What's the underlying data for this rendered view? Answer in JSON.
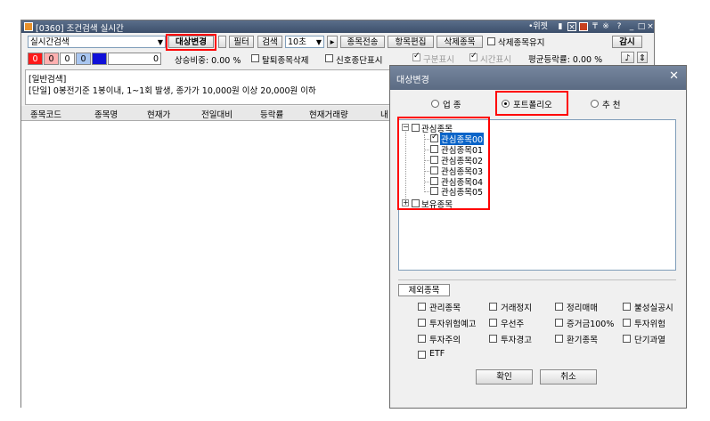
{
  "window": {
    "title": "[0360] 조건검색 실시간",
    "titlebar_icons": [
      "•위젯",
      "lock-icon",
      "x-box-icon",
      "panel-icon",
      "pin-icon",
      "asterisk-icon",
      "?",
      "_",
      "□",
      "×"
    ]
  },
  "toolbar": {
    "search_type": "실시간검색",
    "target_change": "대상변경",
    "filter": "필터",
    "search": "검색",
    "interval": "10초",
    "item_transfer": "종목전송",
    "item_edit": "항목편집",
    "delete_item": "삭제종목",
    "keep_deleted": "삭제종목유지",
    "monitor": "감시"
  },
  "status_row": {
    "cells": [
      "0",
      "0",
      "0",
      "0",
      "",
      "0"
    ],
    "rise_ratio": "상승비중: 0.00 %",
    "exclude_break": "탈퇴종목삭제",
    "signal_show": "신호종단표시",
    "div_show": "구분표시",
    "time_show": "시간표시",
    "avg_rate": "평균등락률: 0.00 %"
  },
  "condition": {
    "line1": "[일반검색]",
    "line2": "[단일] 0봉전기준 1봉이내, 1~1회 발생, 종가가 10,000원 이상 20,000원 이하"
  },
  "grid": {
    "columns": [
      "종목코드",
      "종목명",
      "현재가",
      "전일대비",
      "등락률",
      "현재거래량",
      "내"
    ]
  },
  "dialog": {
    "title": "대상변경",
    "radios": [
      "업 종",
      "포트폴리오",
      "추 천"
    ],
    "selected_radio": 1,
    "tree": {
      "root1": "관심종목",
      "children": [
        "관심종목00",
        "관심종목01",
        "관심종목02",
        "관심종목03",
        "관심종목04",
        "관심종목05"
      ],
      "root2": "보유종목"
    },
    "exclude_tab": "제외종목",
    "exclude_items": [
      [
        "관리종목",
        "거래정지",
        "정리매매",
        "불성실공시"
      ],
      [
        "투자위험예고",
        "우선주",
        "증거금100%",
        "투자위험"
      ],
      [
        "투자주의",
        "투자경고",
        "환기종목",
        "단기과열"
      ],
      [
        "ETF"
      ]
    ],
    "ok": "확인",
    "cancel": "취소"
  }
}
